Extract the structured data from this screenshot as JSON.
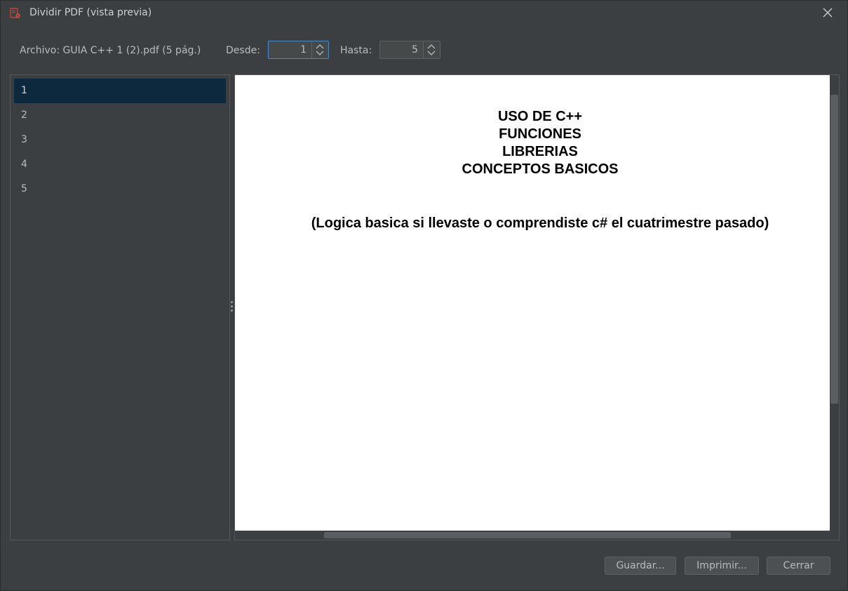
{
  "window": {
    "title": "Dividir PDF (vista previa)",
    "app_icon": "pdf-app-icon",
    "close_icon": "close-icon"
  },
  "toolbar": {
    "file_label": "Archivo: GUIA C++ 1 (2).pdf (5 pág.)",
    "from_label": "Desde:",
    "from_value": "1",
    "to_label": "Hasta:",
    "to_value": "5"
  },
  "pages": {
    "items": [
      "1",
      "2",
      "3",
      "4",
      "5"
    ],
    "selected": "1"
  },
  "preview": {
    "title_lines": [
      "USO DE C++",
      "FUNCIONES",
      "LIBRERIAS",
      "CONCEPTOS BASICOS"
    ],
    "subtitle": "(Logica basica si llevaste o comprendiste c# el cuatrimestre pasado)"
  },
  "buttons": {
    "save": "Guardar...",
    "print": "Imprimir...",
    "close": "Cerrar"
  },
  "colors": {
    "background": "#3c3f41",
    "selection": "#0d293e",
    "focus_border": "#4a88c7",
    "app_icon_red": "#e0443e"
  }
}
